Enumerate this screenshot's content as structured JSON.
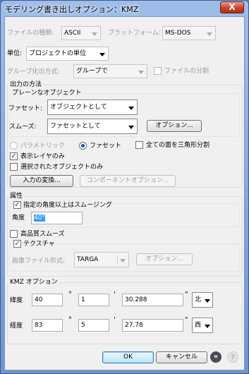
{
  "window": {
    "title": "モデリング書き出しオプション：KMZ",
    "close_glyph": "X"
  },
  "top": {
    "file_type_label": "ファイルの種類:",
    "file_type_value": "ASCII",
    "platform_label": "プラットフォーム:",
    "platform_value": "MS-DOS",
    "unit_label": "単位:",
    "unit_value": "プロジェクトの単位",
    "group_method_label": "グループ化の方式:",
    "group_method_value": "グループで",
    "split_files_label": "ファイルの分割"
  },
  "output": {
    "title": "出力の方法",
    "plain_objects_title": "プレーンなオブジェクト",
    "facet_label": "ファセット:",
    "facet_value": "オブジェクトとして",
    "smooth_label": "スムーズ:",
    "smooth_value": "ファセットとして",
    "options_button": "オプション...",
    "radio_parametric": "パラメトリック",
    "radio_facet": "ファセット",
    "triangulate_label": "全ての面を三角形分割",
    "show_layers_label": "表示レイヤのみ",
    "show_layers_checked": true,
    "selected_only_label": "選択されたオブジェクトのみ",
    "selected_only_checked": false,
    "input_convert_button": "入力の変換...",
    "component_options_button": "コンポーネントオプション..."
  },
  "attributes": {
    "title": "属性",
    "smoothing_label": "指定の角度以上はスムージング",
    "smoothing_checked": true,
    "angle_label": "角度",
    "angle_value": "40°",
    "hq_smooth_label": "高品質スムーズ",
    "hq_smooth_checked": false,
    "texture_label": "テクスチャ",
    "texture_checked": true,
    "image_format_label": "画像ファイル形式:",
    "image_format_value": "TARGA",
    "image_options_button": "オプション..."
  },
  "kmz": {
    "title": "KMZ オプション",
    "latitude_label": "緯度",
    "lat_deg": "40",
    "lat_min": "1",
    "lat_sec": "30.288",
    "lat_dir": "北",
    "longitude_label": "経度",
    "lon_deg": "83",
    "lon_min": "5",
    "lon_sec": "27.78",
    "lon_dir": "西",
    "deg_sym": "°",
    "min_sym": "'",
    "sec_sym": "\""
  },
  "footer": {
    "ok_button": "OK",
    "cancel_button": "キャンセル",
    "back_icon": "«",
    "help_icon": "?"
  }
}
